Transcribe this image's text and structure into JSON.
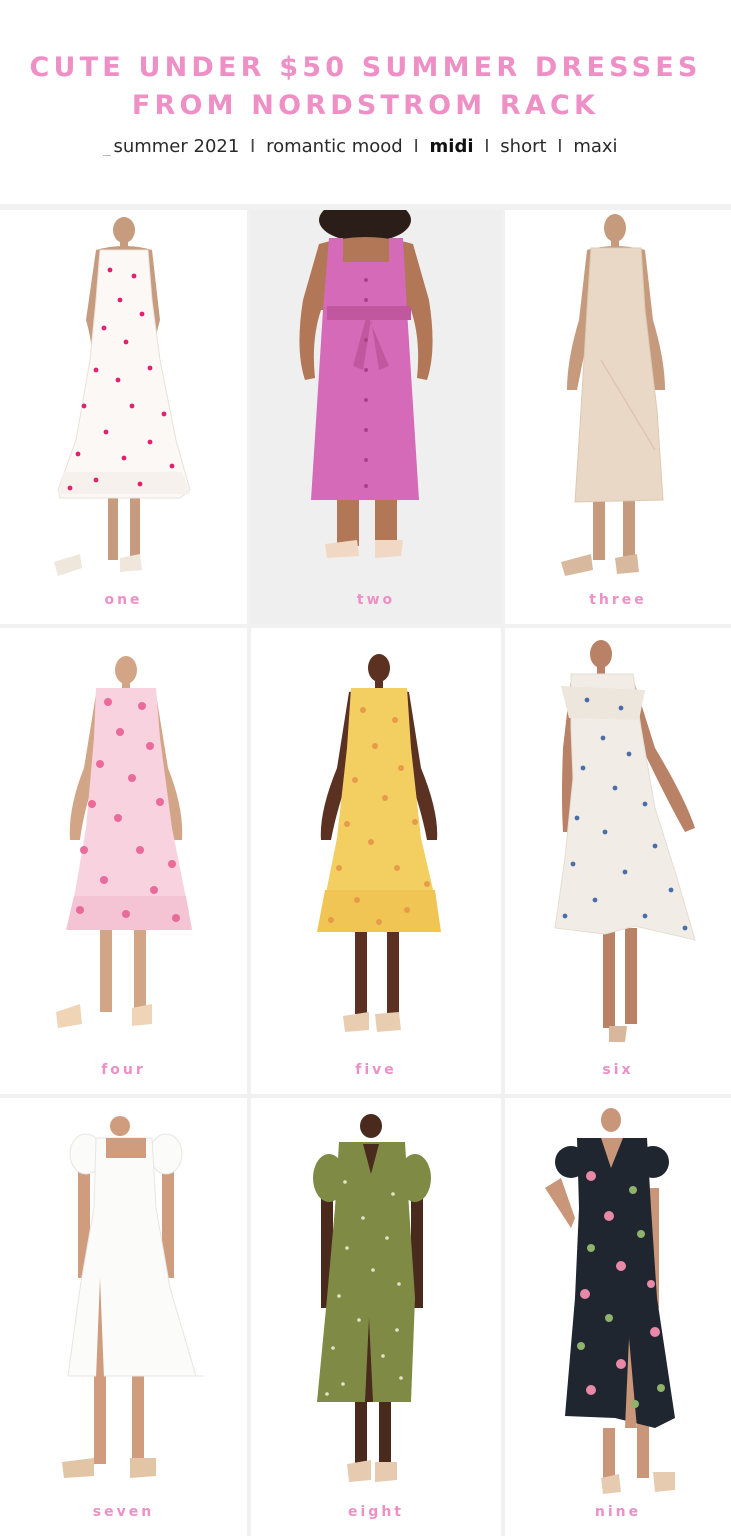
{
  "header": {
    "title_line1": "CUTE UNDER $50 SUMMER DRESSES",
    "title_line2": "FROM NORDSTROM RACK",
    "nav": {
      "items": [
        "summer 2021",
        "romantic mood",
        "midi",
        "short",
        "maxi"
      ],
      "separator": "I",
      "active": "midi"
    }
  },
  "colors": {
    "accent_pink": "#ee8fc6",
    "divider_grey": "#f1f1f1"
  },
  "products": [
    {
      "label": "one",
      "dress_color": "#fbf8f5",
      "pattern_color": "#e0216e",
      "pattern": "cherry-print"
    },
    {
      "label": "two",
      "dress_color": "#d46ab8",
      "pattern": "solid-button-front"
    },
    {
      "label": "three",
      "dress_color": "#e9d8c6",
      "pattern": "solid-slip"
    },
    {
      "label": "four",
      "dress_color": "#f8d3df",
      "pattern_color": "#ea6a9a",
      "pattern": "pink-floral"
    },
    {
      "label": "five",
      "dress_color": "#f3cf62",
      "pattern_color": "#e79b4a",
      "pattern": "yellow-floral"
    },
    {
      "label": "six",
      "dress_color": "#f1ede6",
      "pattern_color": "#4b6ea9",
      "pattern": "blue-floral"
    },
    {
      "label": "seven",
      "dress_color": "#fbfbfa",
      "pattern": "white-puff-sleeve"
    },
    {
      "label": "eight",
      "dress_color": "#7f8a45",
      "pattern_color": "#e6e2c8",
      "pattern": "olive-ditsy"
    },
    {
      "label": "nine",
      "dress_color": "#1f2630",
      "pattern_color": "#e889a7",
      "pattern": "dark-floral"
    }
  ]
}
